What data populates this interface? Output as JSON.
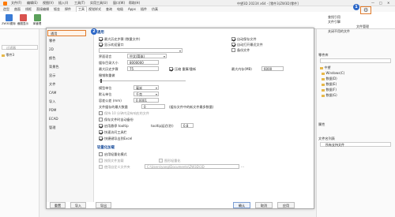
{
  "titlebar": {
    "menus": [
      "文件(F)",
      "编辑(E)",
      "视图(V)",
      "插入(I)",
      "工具(T)",
      "实用工具(U)",
      "窗口(W)",
      "帮助(H)"
    ],
    "window_title": "中望3D 2023X x64 - [零件3(ZW3D)零件]"
  },
  "ribbon_tabs": [
    "造型",
    "曲面",
    "线框",
    "直接编辑",
    "钣金",
    "焊件",
    "工具",
    "视觉样式",
    "查询",
    "电极",
    "Apps",
    "插件",
    "仿真"
  ],
  "ribbon_active_tab": "工具",
  "ribbon_buttons": [
    "ZW3D图标",
    "截图显示",
    "库管理"
  ],
  "left_panel": {
    "search_placeholder": "过滤器",
    "rows": [
      "零件3",
      "",
      "",
      "",
      ""
    ]
  },
  "right_panel": {
    "top_items": [
      "查找引用",
      "文件引擎",
      "文件管理",
      "关闭不用的文件"
    ],
    "section1": "零件库",
    "folders_title": "中望",
    "folders": [
      "Windows(C)",
      "数据(D)",
      "数据(E)",
      "数据(F)",
      "数据(G)"
    ],
    "section2": "属性",
    "filter_label": "文件名列表",
    "filter_value": "所有支持文件",
    "attr_rows": [
      "",
      "",
      "",
      "",
      "",
      "",
      ""
    ]
  },
  "dialog": {
    "nav": [
      "通用",
      "零件",
      "2D",
      "颜色",
      "背景色",
      "显示",
      "文件",
      "CAM",
      "导入",
      "PDM",
      "ECAD",
      "管理"
    ],
    "nav_active_index": 0,
    "section_general": "通用",
    "section_lightweight": "轻量化加载",
    "rows": {
      "cb_prompt_save": "最大历史步骤 (数量文件)",
      "cb_show_welcome": "显示欢迎窗口",
      "cb_auto_save": "自动保存文件",
      "cb_start_page": "自动打开最近文件",
      "cb_save_backup": "备份文件",
      "lbl_language": "界面语言",
      "val_language": "中文(简体)",
      "lbl_cache": "缓存目录大小",
      "val_cache": "8000000",
      "lbl_max_history": "最大历史步骤",
      "val_max_history": "75",
      "cb_history_recalc": "压缩 重算/重新",
      "lbl_max_mem": "最大内存(MB)",
      "val_max_mem": "6000",
      "lbl_undo": "撤销和重做",
      "lbl_unit": "模型单位",
      "val_unit": "毫米",
      "lbl_default_unit": "默认单位",
      "val_default_unit": "千克",
      "lbl_tolerance": "容差公差 (mm)",
      "val_tolerance": "0.0001",
      "lbl_file_cache": "文件缓存的最大数量",
      "val_file_cache": "0",
      "lbl_cache_note": "(缓存文件中的新文件最多数量)",
      "cb_auto_keep": "保持 10 分钟内没有响应的文件",
      "cb_backup": "保存文件时自动备份",
      "cb_tooltip": "启用悬停 tooltip",
      "lbl_tooltip_delay": "tooltip延迟(秒)",
      "val_tooltip_delay": "0.8",
      "cb_quick_access": "快速访问工具栏",
      "cb_ribbon_excel": "快捷键导出到Excel",
      "cb_lw_enable": "启用轻量化模式",
      "cb_lw_components": "按照文件加载",
      "cb_lw_graphic": "图形轻量化",
      "cb_lw_path": "使用自定义文件夹",
      "val_lw_path": "C:\\Users\\yang\\Documents\\ZW3D\\3D"
    },
    "buttons": {
      "reset": "重置",
      "import": "导入",
      "export": "导出",
      "ok": "确认",
      "cancel": "取消",
      "apply": "应用"
    }
  },
  "markers": {
    "badge1": "1",
    "badge2": "2"
  }
}
